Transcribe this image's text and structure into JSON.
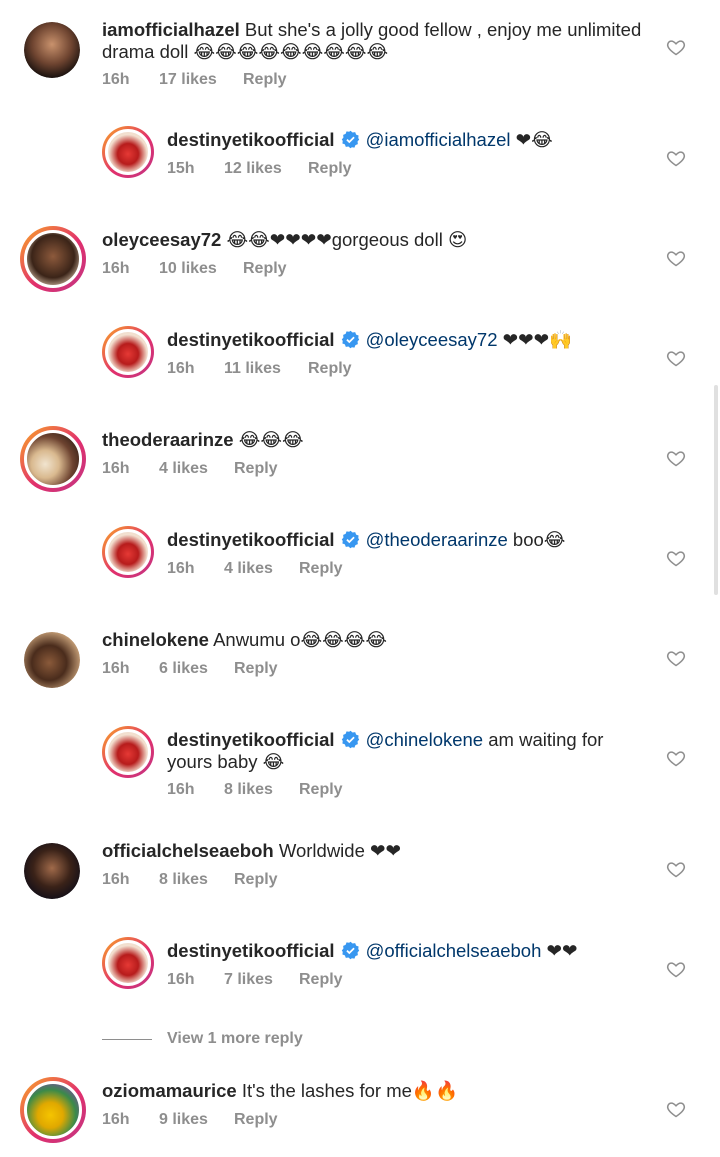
{
  "comments": [
    {
      "user": "iamofficialhazel",
      "verified": false,
      "text": "But she's a jolly good fellow , enjoy me unlimited drama doll 😂😂😂😂😂😂😂😂😂",
      "time": "16h",
      "likes": "17 likes",
      "reply": "Reply"
    },
    {
      "user": "destinyetikoofficial",
      "verified": true,
      "mention": "@iamofficialhazel",
      "text": " ❤😂",
      "time": "15h",
      "likes": "12 likes",
      "reply": "Reply"
    },
    {
      "user": "oleyceesay72",
      "verified": false,
      "text": "😂😂❤❤❤❤gorgeous doll 😍",
      "time": "16h",
      "likes": "10 likes",
      "reply": "Reply"
    },
    {
      "user": "destinyetikoofficial",
      "verified": true,
      "mention": "@oleyceesay72",
      "text": " ❤❤❤🙌",
      "time": "16h",
      "likes": "11 likes",
      "reply": "Reply"
    },
    {
      "user": "theoderaarinze",
      "verified": false,
      "text": "😂😂😂",
      "time": "16h",
      "likes": "4 likes",
      "reply": "Reply"
    },
    {
      "user": "destinyetikoofficial",
      "verified": true,
      "mention": "@theoderaarinze",
      "text": " boo😂",
      "time": "16h",
      "likes": "4 likes",
      "reply": "Reply"
    },
    {
      "user": "chinelokene",
      "verified": false,
      "text": "Anwumu o😂😂😂😂",
      "time": "16h",
      "likes": "6 likes",
      "reply": "Reply"
    },
    {
      "user": "destinyetikoofficial",
      "verified": true,
      "mention": "@chinelokene",
      "text": " am waiting for yours baby 😂",
      "time": "16h",
      "likes": "8 likes",
      "reply": "Reply"
    },
    {
      "user": "officialchelseaeboh",
      "verified": false,
      "text": "Worldwide ❤❤",
      "time": "16h",
      "likes": "8 likes",
      "reply": "Reply"
    },
    {
      "user": "destinyetikoofficial",
      "verified": true,
      "mention": "@officialchelseaeboh",
      "text": " ❤❤",
      "time": "16h",
      "likes": "7 likes",
      "reply": "Reply"
    },
    {
      "user": "oziomamaurice",
      "verified": false,
      "text": "It's the lashes for me🔥🔥",
      "time": "16h",
      "likes": "9 likes",
      "reply": "Reply"
    }
  ],
  "view_more": "View 1 more reply",
  "colors": {
    "text": "#262626",
    "meta": "#8e8e8e",
    "mention": "#00376b",
    "verified": "#3897f0",
    "ring_start": "#f9a825",
    "ring_end": "#c13584"
  },
  "icons": {
    "like": "heart-outline-icon",
    "verified": "verified-badge-icon"
  }
}
